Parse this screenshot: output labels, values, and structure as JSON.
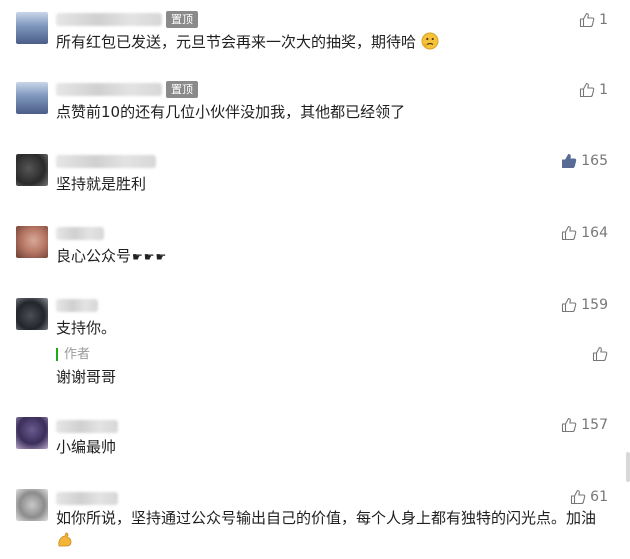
{
  "comments": [
    {
      "pinned_label": "置顶",
      "text": "所有红包已发送，元旦节会再来一次大的抽奖，期待哈",
      "likes": "1",
      "liked": false
    },
    {
      "pinned_label": "置顶",
      "text": "点赞前10的还有几位小伙伴没加我，其他都已经领了",
      "likes": "1",
      "liked": false
    },
    {
      "text": "坚持就是胜利",
      "likes": "165",
      "liked": true
    },
    {
      "text": "良心公众号",
      "likes": "164",
      "liked": false
    },
    {
      "text": "支持你。",
      "likes": "159",
      "liked": false,
      "reply": {
        "label": "作者",
        "text": "谢谢哥哥"
      }
    },
    {
      "text": "小编最帅",
      "likes": "157",
      "liked": false
    },
    {
      "text": "如你所说，坚持通过公众号输出自己的价值，每个人身上都有独特的闪光点。加油",
      "likes": "61",
      "liked": false
    }
  ],
  "icons": {
    "like": "thumbs-up-outline-icon",
    "liked": "thumbs-up-filled-icon",
    "emoji_thinking": "thinking-face-emoji",
    "emoji_flex": "flexed-biceps-emoji",
    "emoji_hands": "pointing-hand-emoji"
  },
  "colors": {
    "liked": "#576b95",
    "reply_bar": "#1aad19",
    "badge": "#8a8a8a"
  }
}
